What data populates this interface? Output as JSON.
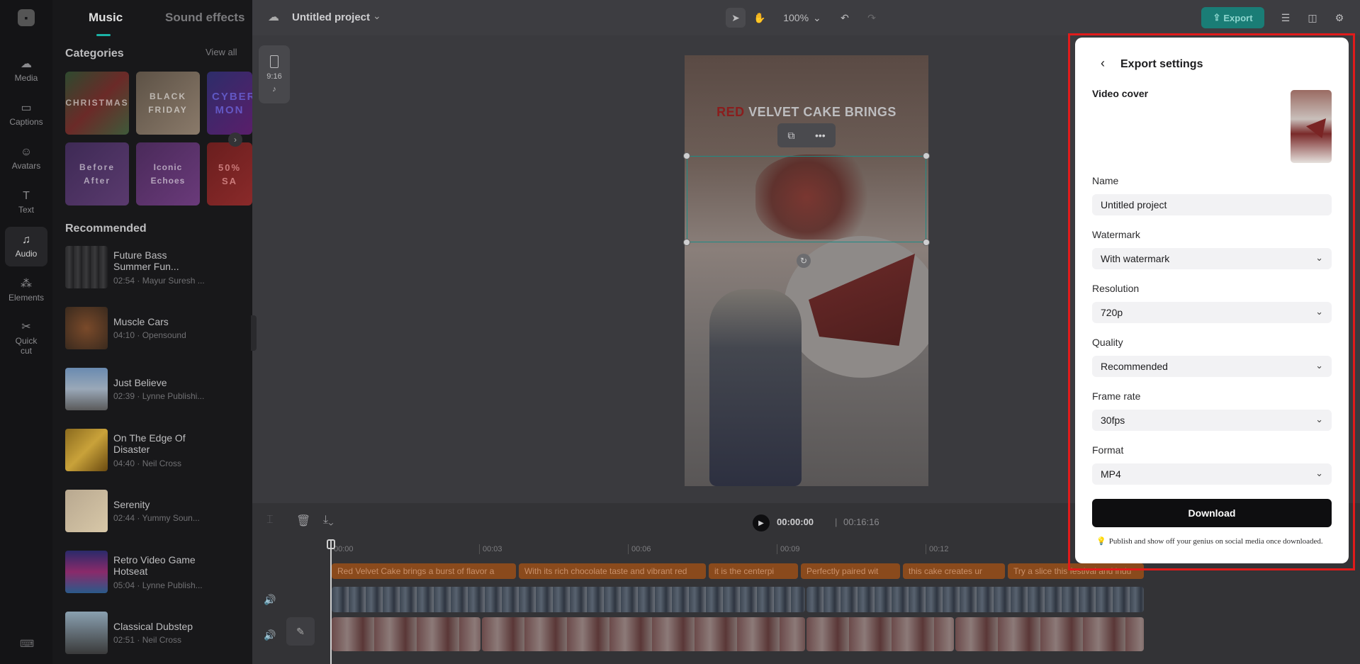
{
  "rail": {
    "items": [
      {
        "label": "Media",
        "icon": "cloud-upload-icon",
        "glyph": "☁"
      },
      {
        "label": "Captions",
        "icon": "captions-icon",
        "glyph": "▭"
      },
      {
        "label": "Avatars",
        "icon": "avatar-icon",
        "glyph": "☺"
      },
      {
        "label": "Text",
        "icon": "text-icon",
        "glyph": "T"
      },
      {
        "label": "Audio",
        "icon": "music-note-icon",
        "glyph": "♫"
      },
      {
        "label": "Elements",
        "icon": "elements-icon",
        "glyph": "⁂"
      },
      {
        "label": "Quick cut",
        "icon": "quick-cut-icon",
        "glyph": "✂"
      }
    ]
  },
  "panel": {
    "tabs": [
      "Music",
      "Sound effects"
    ],
    "categories_title": "Categories",
    "view_all": "View all",
    "categories": [
      "CHRISTMAS",
      "BLACK FRIDAY",
      "CYBER MON",
      "Before After",
      "Iconic Echoes",
      "50% SA"
    ],
    "recommended_title": "Recommended",
    "tracks": [
      {
        "name": "Future Bass Summer Fun...",
        "meta": "02:54 · Mayur Suresh ..."
      },
      {
        "name": "Muscle Cars",
        "meta": "04:10 · Opensound"
      },
      {
        "name": "Just Believe",
        "meta": "02:39 · Lynne Publishi..."
      },
      {
        "name": "On The Edge Of Disaster",
        "meta": "04:40 · Neil Cross"
      },
      {
        "name": "Serenity",
        "meta": "02:44 · Yummy Soun..."
      },
      {
        "name": "Retro Video Game Hotseat",
        "meta": "05:04 · Lynne Publish..."
      },
      {
        "name": "Classical Dubstep",
        "meta": "02:51 · Neil Cross"
      }
    ]
  },
  "topbar": {
    "project_title": "Untitled project",
    "zoom": "100%",
    "export_label": "Export"
  },
  "canvas": {
    "ratio": "9:16",
    "title_red": "RED",
    "title_rest": " VELVET CAKE BRINGS"
  },
  "timeline": {
    "current_time": "00:00:00",
    "separator": "|",
    "total_time": "00:16:16",
    "ruler": [
      "00:00",
      "00:03",
      "00:06",
      "00:09",
      "00:12"
    ],
    "captions": [
      "Red Velvet Cake brings a burst of flavor a",
      "With its rich chocolate taste and vibrant red",
      "it is the centerpi",
      "Perfectly paired wit",
      "this cake creates ur",
      "Try a slice this festival and indu"
    ]
  },
  "export": {
    "title": "Export settings",
    "video_cover_label": "Video cover",
    "name_label": "Name",
    "name_value": "Untitled project",
    "watermark_label": "Watermark",
    "watermark_value": "With watermark",
    "resolution_label": "Resolution",
    "resolution_value": "720p",
    "quality_label": "Quality",
    "quality_value": "Recommended",
    "framerate_label": "Frame rate",
    "framerate_value": "30fps",
    "format_label": "Format",
    "format_value": "MP4",
    "download_label": "Download",
    "publish_note": "Publish and show off your genius on social media once downloaded."
  },
  "colors": {
    "accent": "#1bb3a6",
    "highlight_frame": "#e01b1b"
  }
}
